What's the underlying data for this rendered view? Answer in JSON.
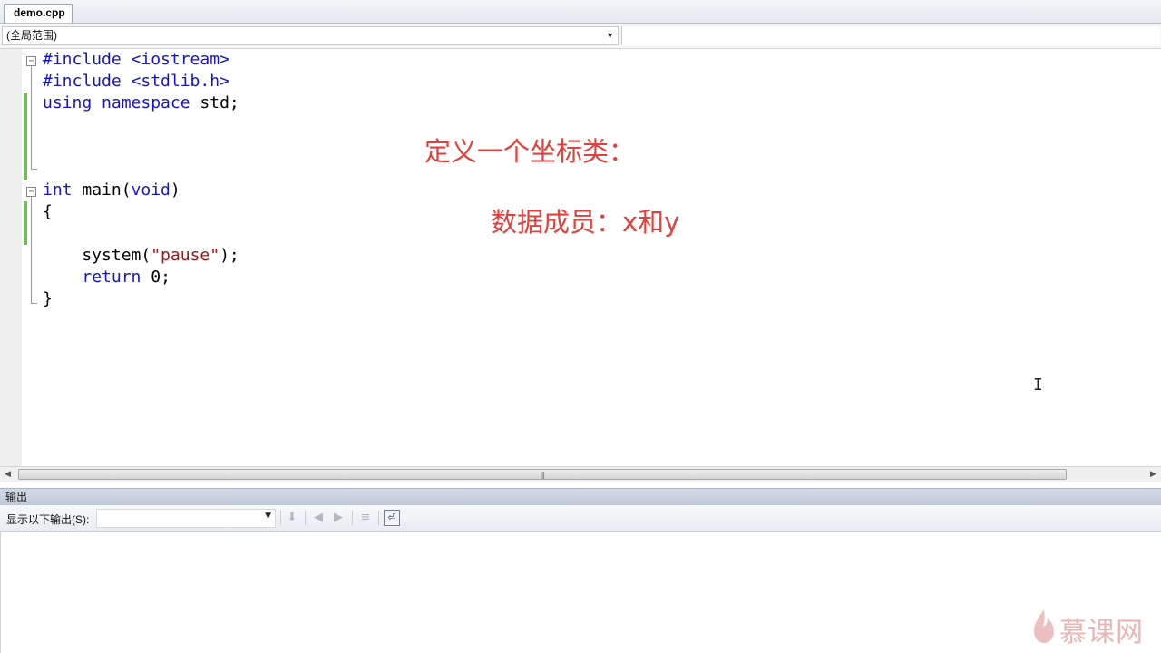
{
  "tab": {
    "filename": "demo.cpp"
  },
  "scope": {
    "selected": "(全局范围)"
  },
  "code": {
    "line1": {
      "directive": "#include",
      "header": " <iostream>"
    },
    "line2": {
      "directive": "#include",
      "header": " <stdlib.h>"
    },
    "line3": {
      "kw1": "using",
      "kw2": " namespace",
      "rest": " std;"
    },
    "line4": {
      "type": "int",
      "name": " main(",
      "param": "void",
      "close": ")"
    },
    "line5": "{",
    "line6": {
      "indent": "    system(",
      "str": "\"pause\"",
      "end": ");"
    },
    "line7": {
      "indent": "    ",
      "kw": "return",
      "rest": " 0;"
    },
    "line8": "}"
  },
  "annotations": {
    "title": "定义一个坐标类：",
    "members": "数据成员：x和y"
  },
  "output": {
    "title": "输出",
    "show_label": "显示以下输出(S):",
    "source_value": ""
  },
  "watermark": "慕课网",
  "colors": {
    "keyword": "#1515c8",
    "string": "#a31515",
    "annotation": "#e2403c",
    "change_bar": "#6dbf5a"
  },
  "icons": {
    "dropdown": "chevron-down-icon",
    "fold_collapse": "minus-box-icon",
    "find_message": "find-in-output-icon",
    "prev_message": "go-to-previous-message-icon",
    "next_message": "go-to-next-message-icon",
    "clear_all": "clear-all-icon",
    "word_wrap": "toggle-word-wrap-icon",
    "text_cursor": "i-beam-cursor-icon",
    "brand": "flame-logo-icon"
  }
}
